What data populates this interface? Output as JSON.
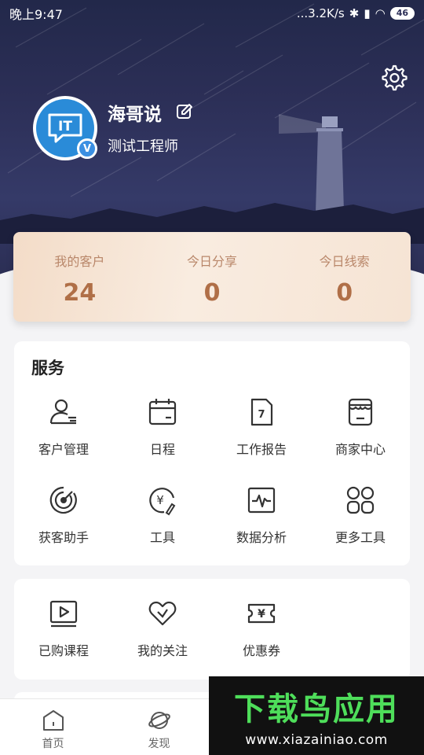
{
  "status_bar": {
    "time": "晚上9:47",
    "speed": "...3.2K/s",
    "battery": "46"
  },
  "profile": {
    "name": "海哥说",
    "avatar_text": "IT",
    "badge": "V",
    "title": "测试工程师"
  },
  "stats": [
    {
      "label": "我的客户",
      "value": "24"
    },
    {
      "label": "今日分享",
      "value": "0"
    },
    {
      "label": "今日线索",
      "value": "0"
    }
  ],
  "services": {
    "heading": "服务",
    "items": [
      {
        "label": "客户管理",
        "icon": "customer-management-icon"
      },
      {
        "label": "日程",
        "icon": "calendar-icon"
      },
      {
        "label": "工作报告",
        "icon": "work-report-icon"
      },
      {
        "label": "商家中心",
        "icon": "store-icon"
      },
      {
        "label": "获客助手",
        "icon": "radar-icon"
      },
      {
        "label": "工具",
        "icon": "tools-icon"
      },
      {
        "label": "数据分析",
        "icon": "data-analysis-icon"
      },
      {
        "label": "更多工具",
        "icon": "more-tools-icon"
      }
    ]
  },
  "mine": {
    "items": [
      {
        "label": "已购课程",
        "icon": "video-course-icon"
      },
      {
        "label": "我的关注",
        "icon": "heart-icon"
      },
      {
        "label": "优惠券",
        "icon": "coupon-icon"
      }
    ]
  },
  "report_icon_digit": "7",
  "tools_icon_glyph": "¥",
  "coupon_icon_glyph": "¥",
  "bottom_nav": [
    {
      "label": "首页",
      "icon": "home-icon"
    },
    {
      "label": "发现",
      "icon": "planet-icon"
    }
  ],
  "watermark": {
    "title": "下载鸟应用",
    "url": "www.xiazainiao.com"
  },
  "colors": {
    "hero": "#2c2f57",
    "accent": "#b06f47",
    "watermark_green": "#4ede5a"
  }
}
